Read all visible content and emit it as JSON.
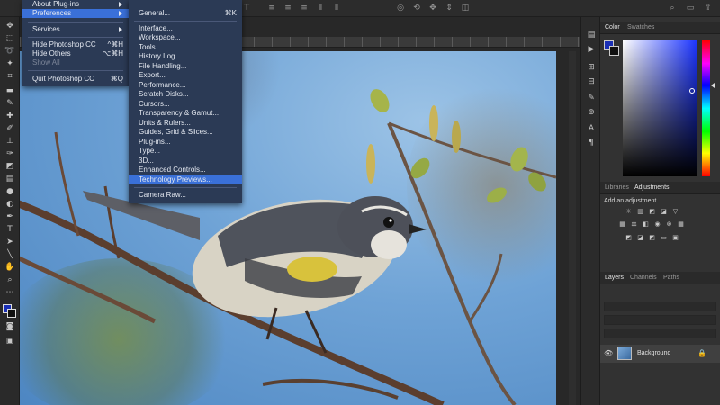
{
  "colors": {
    "accent": "#3a70d8",
    "menu_bg": "#2b3a55",
    "foreground_color": "#1a2fb5"
  },
  "app_menu": {
    "items": [
      {
        "label": "About Plug-ins",
        "has_submenu": true
      },
      {
        "label": "Preferences",
        "has_submenu": true,
        "highlighted": true
      },
      {
        "label": "Services",
        "has_submenu": true
      },
      {
        "label": "Hide Photoshop CC",
        "shortcut": "^⌘H"
      },
      {
        "label": "Hide Others",
        "shortcut": "⌥⌘H"
      },
      {
        "label": "Show All",
        "disabled": true
      },
      {
        "label": "Quit Photoshop CC",
        "shortcut": "⌘Q"
      }
    ]
  },
  "preferences_menu": {
    "items": [
      {
        "label": "General...",
        "shortcut": "⌘K"
      },
      {
        "label": "Interface..."
      },
      {
        "label": "Workspace..."
      },
      {
        "label": "Tools..."
      },
      {
        "label": "History Log..."
      },
      {
        "label": "File Handling..."
      },
      {
        "label": "Export..."
      },
      {
        "label": "Performance..."
      },
      {
        "label": "Scratch Disks..."
      },
      {
        "label": "Cursors..."
      },
      {
        "label": "Transparency & Gamut..."
      },
      {
        "label": "Units & Rulers..."
      },
      {
        "label": "Guides, Grid & Slices..."
      },
      {
        "label": "Plug-ins..."
      },
      {
        "label": "Type..."
      },
      {
        "label": "3D..."
      },
      {
        "label": "Enhanced Controls..."
      },
      {
        "label": "Technology Previews...",
        "highlighted": true
      },
      {
        "label": "Camera Raw..."
      }
    ]
  },
  "panels": {
    "color_tabs": [
      "Color",
      "Swatches"
    ],
    "adjust_tabs": [
      "Libraries",
      "Adjustments"
    ],
    "adjustments_hint": "Add an adjustment",
    "layers_tabs": [
      "Layers",
      "Channels",
      "Paths"
    ],
    "layer_name": "Background"
  },
  "toolbox": {
    "icons": [
      "move-icon",
      "marquee-icon",
      "lasso-icon",
      "magic-wand-icon",
      "crop-icon",
      "eyedropper-icon",
      "healing-brush-icon",
      "brush-icon",
      "clone-stamp-icon",
      "history-brush-icon",
      "eraser-icon",
      "gradient-icon",
      "blur-icon",
      "dodge-icon",
      "pen-icon",
      "type-icon",
      "path-selection-icon",
      "shape-icon",
      "hand-icon",
      "zoom-icon",
      "more-tools-icon"
    ]
  }
}
